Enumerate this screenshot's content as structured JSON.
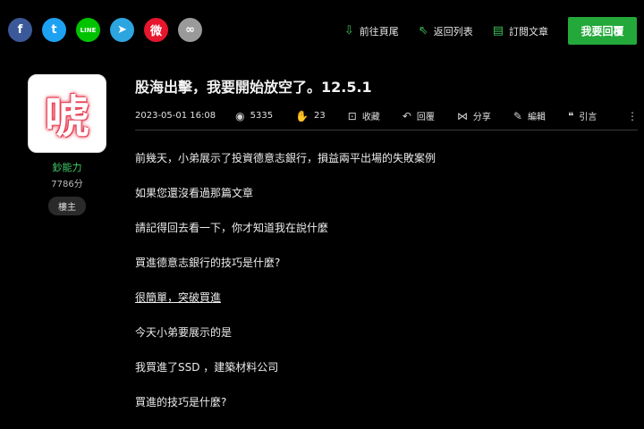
{
  "share": {
    "facebook": "f",
    "twitter": "t",
    "line": "LINE",
    "telegram": "➤",
    "weibo": "微",
    "link": "∞"
  },
  "nav": {
    "goto_bottom": "前往頁尾",
    "back_to_list": "返回列表",
    "subscribe": "訂閱文章",
    "reply_button": "我要回覆"
  },
  "author": {
    "avatar_char": "唬",
    "name": "鈔能力",
    "score": "7786分",
    "role": "樓主"
  },
  "post": {
    "title": "股海出擊，我要開始放空了。12.5.1",
    "date": "2023-05-01 16:08",
    "views": "5335",
    "likes": "23",
    "bookmark": "收藏",
    "reply": "回覆",
    "share": "分享",
    "edit": "編輯",
    "quote": "引言",
    "more": "⋮",
    "lines": [
      "前幾天，小弟展示了投資德意志銀行，損益兩平出場的失敗案例",
      "如果您還沒看過那篇文章",
      "請記得回去看一下，你才知道我在說什麼",
      "買進德意志銀行的技巧是什麼?",
      "很簡單，突破買進",
      "今天小弟要展示的是",
      "我買進了SSD ，建築材料公司",
      "買進的技巧是什麼?"
    ]
  },
  "colors": {
    "accent_green": "#23a83a",
    "name_green": "#3fd16a"
  }
}
